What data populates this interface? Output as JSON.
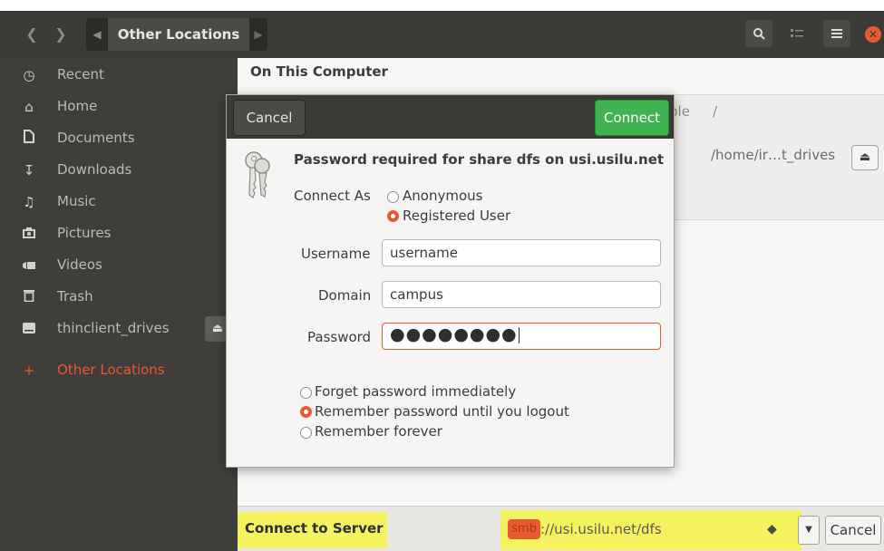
{
  "header": {
    "back_icon": "chevron-left-icon",
    "forward_icon": "chevron-right-icon",
    "path_current": "Other Locations",
    "buttons": [
      "search-icon",
      "view-options-icon",
      "menu-icon",
      "close-icon"
    ]
  },
  "sidebar": {
    "items": [
      {
        "label": "Recent",
        "icon": "clock-icon"
      },
      {
        "label": "Home",
        "icon": "home-icon"
      },
      {
        "label": "Documents",
        "icon": "document-icon"
      },
      {
        "label": "Downloads",
        "icon": "download-icon"
      },
      {
        "label": "Music",
        "icon": "music-icon"
      },
      {
        "label": "Pictures",
        "icon": "camera-icon"
      },
      {
        "label": "Videos",
        "icon": "video-icon"
      },
      {
        "label": "Trash",
        "icon": "trash-icon"
      },
      {
        "label": "thinclient_drives",
        "icon": "drive-icon"
      },
      {
        "label": "Other Locations",
        "icon": "plus-icon"
      }
    ]
  },
  "main": {
    "section_title": "On This Computer",
    "bg_text_partial": "ble",
    "bg_root": "/",
    "bg_path": "/home/ir…t_drives"
  },
  "bottom": {
    "connect_label": "Connect to Server",
    "url_scheme": "smb",
    "url_rest": "://usi.usilu.net/dfs",
    "cancel_label": "Cancel"
  },
  "dialog": {
    "cancel_label": "Cancel",
    "connect_label": "Connect",
    "title": "Password required for share dfs on usi.usilu.net",
    "connect_as_label": "Connect As",
    "connect_as_options": [
      "Anonymous",
      "Registered User"
    ],
    "connect_as_selected": "Registered User",
    "username_label": "Username",
    "username_value": "username",
    "domain_label": "Domain",
    "domain_value": "campus",
    "password_label": "Password",
    "password_value": "●●●●●●●●",
    "remember_options": [
      "Forget password immediately",
      "Remember password until you logout",
      "Remember forever"
    ],
    "remember_selected": "Remember password until you logout"
  },
  "colors": {
    "accent": "#e9592f",
    "connect_green": "#3eb34f",
    "highlight": "#f4f25e",
    "header_dark": "#3b3a37",
    "sidebar_dark": "#3f3e3b"
  }
}
